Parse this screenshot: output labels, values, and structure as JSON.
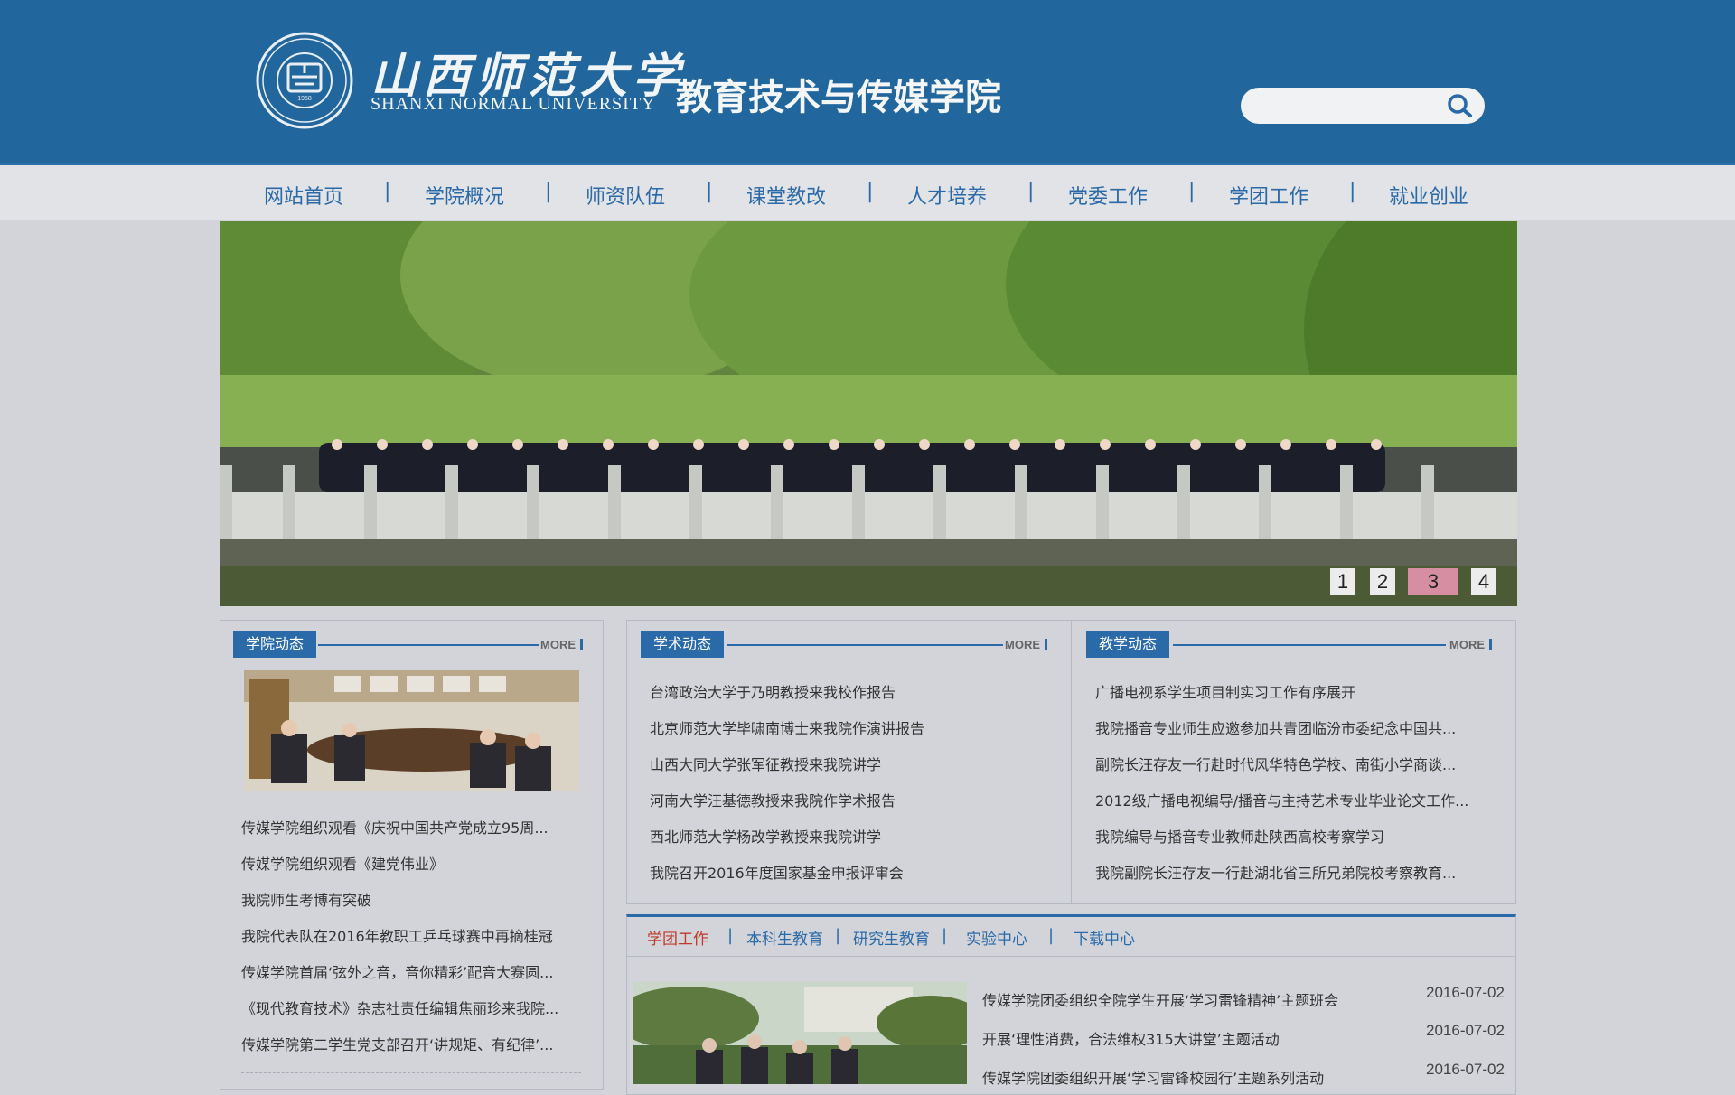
{
  "header": {
    "university_cn": "山西师范大学",
    "university_en": "SHANXI NORMAL UNIVERSITY",
    "seal_text": "SHANXI NORMAL UNIVERSITY 1958",
    "college": "教育技术与传媒学院",
    "search": {
      "placeholder": "",
      "value": ""
    }
  },
  "nav": [
    "网站首页",
    "学院概况",
    "师资队伍",
    "课堂教改",
    "人才培养",
    "党委工作",
    "学团工作",
    "就业创业"
  ],
  "nav_separator": "|",
  "banner": {
    "pagers": [
      "1",
      "2",
      "3",
      "4"
    ],
    "active_index": 3
  },
  "sections": {
    "college_news": {
      "title": "学院动态",
      "more": "MORE",
      "items": [
        "传媒学院组织观看《庆祝中国共产党成立95周...",
        "传媒学院组织观看《建党伟业》",
        "我院师生考博有突破",
        "我院代表队在2016年教职工乒乓球赛中再摘桂冠",
        "传媒学院首届‘弦外之音，音你精彩’配音大赛圆...",
        "《现代教育技术》杂志社责任编辑焦丽珍来我院...",
        "传媒学院第二学生党支部召开‘讲规矩、有纪律’..."
      ]
    },
    "academic_news": {
      "title": "学术动态",
      "more": "MORE",
      "items": [
        "台湾政治大学于乃明教授来我校作报告",
        "北京师范大学毕啸南博士来我院作演讲报告",
        "山西大同大学张军征教授来我院讲学",
        "河南大学汪基德教授来我院作学术报告",
        "西北师范大学杨改学教授来我院讲学",
        "我院召开2016年度国家基金申报评审会"
      ]
    },
    "teaching_news": {
      "title": "教学动态",
      "more": "MORE",
      "items": [
        "广播电视系学生项目制实习工作有序展开",
        "我院播音专业师生应邀参加共青团临汾市委纪念中国共...",
        "副院长汪存友一行赴时代风华特色学校、南街小学商谈...",
        "2012级广播电视编导/播音与主持艺术专业毕业论文工作...",
        "我院编导与播音专业教师赴陕西高校考察学习",
        "我院副院长汪存友一行赴湖北省三所兄弟院校考察教育..."
      ]
    },
    "student_work": {
      "tabs": [
        "学团工作",
        "本科生教育",
        "研究生教育",
        "实验中心",
        "下载中心"
      ],
      "separator": "|",
      "items": [
        {
          "title": "传媒学院团委组织全院学生开展‘学习雷锋精神’主题班会",
          "date": "2016-07-02"
        },
        {
          "title": "开展‘理性消费，合法维权315大讲堂’主题活动",
          "date": "2016-07-02"
        },
        {
          "title": "传媒学院团委组织开展‘学习雷锋校园行’主题系列活动",
          "date": "2016-07-02"
        }
      ]
    }
  },
  "colors": {
    "header_blue": "#21669c",
    "link_blue": "#2a6aa8",
    "active_tab_red": "#c0392b",
    "pager_active": "#d68fa2"
  }
}
